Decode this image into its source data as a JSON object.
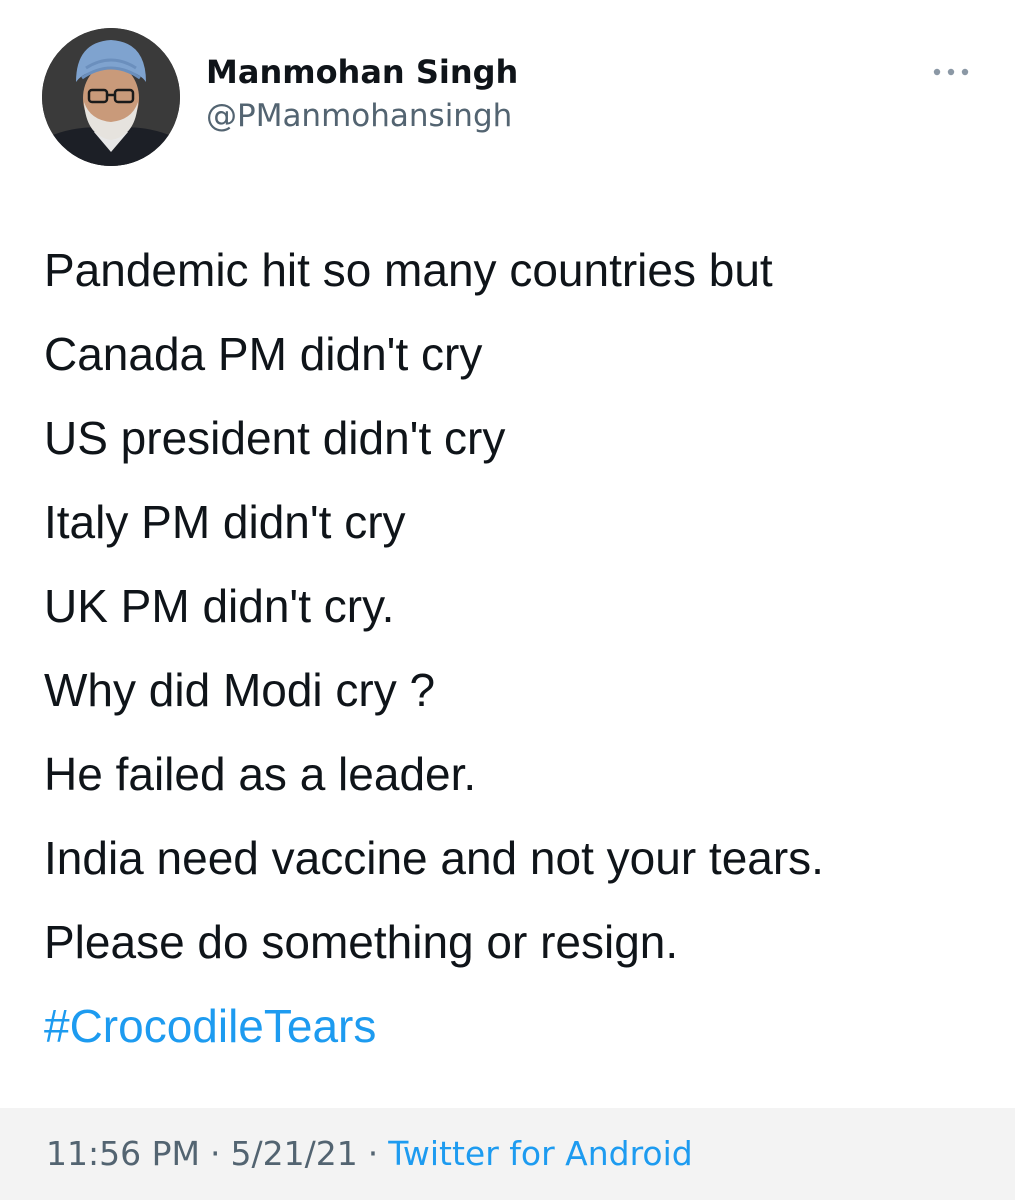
{
  "author": {
    "display_name": "Manmohan Singh",
    "handle": "@PManmohansingh"
  },
  "tweet": {
    "lines": [
      "Pandemic hit so many countries but",
      "Canada PM didn't cry",
      "US president didn't cry",
      "Italy PM didn't cry",
      "UK PM didn't cry.",
      "Why did Modi cry ?",
      "He failed as a leader.",
      "India need vaccine and not your tears.",
      "Please do something or resign."
    ],
    "hashtag": "#CrocodileTears"
  },
  "meta": {
    "time": "11:56 PM",
    "separator": "·",
    "date": "5/21/21",
    "source": "Twitter for Android"
  },
  "icons": {
    "more": "more-horizontal-icon"
  },
  "colors": {
    "link": "#1d9bf0",
    "secondary_text": "#536471",
    "primary_text": "#0f1419",
    "footer_bg": "#f3f3f3"
  }
}
